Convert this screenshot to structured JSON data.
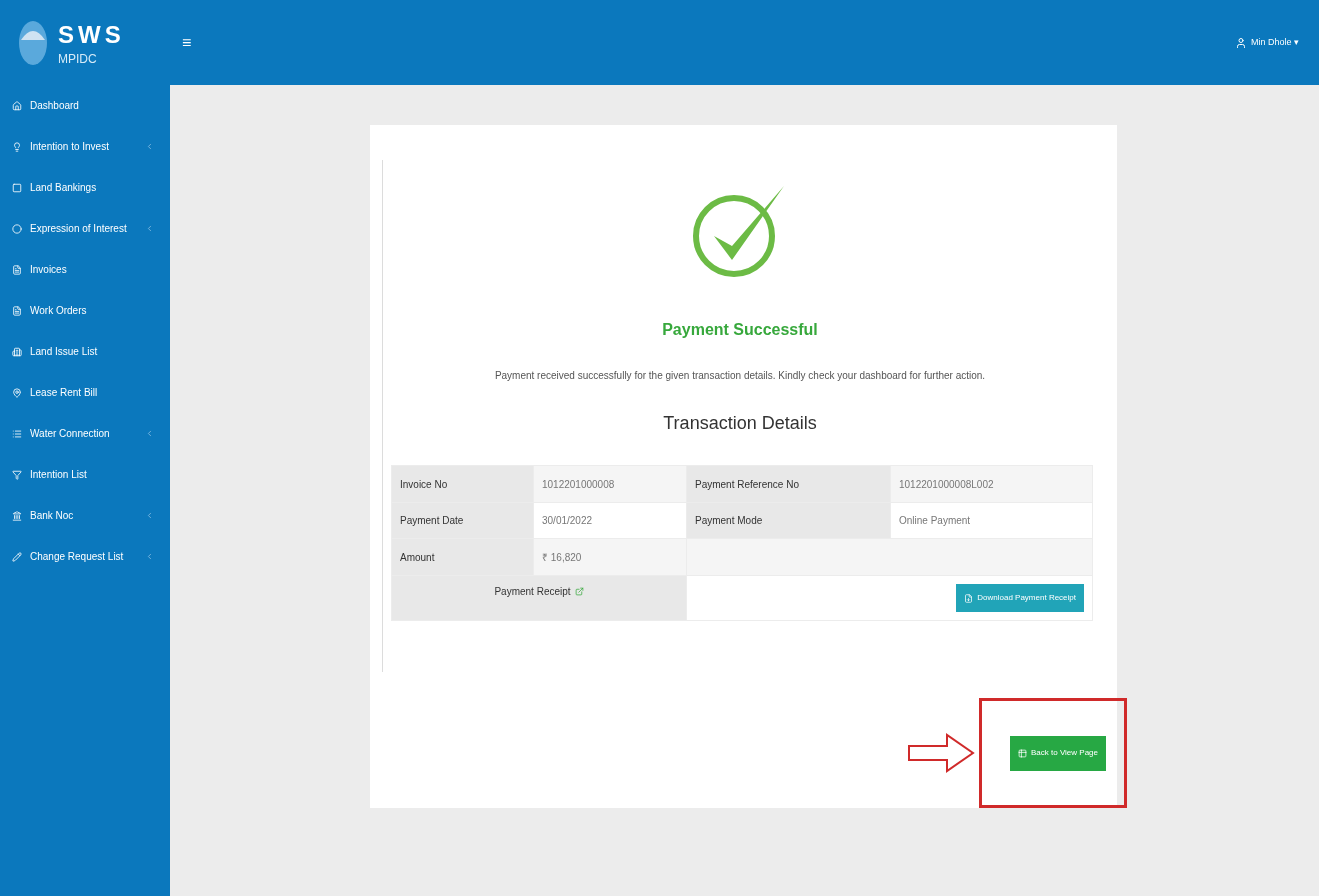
{
  "brand": {
    "title": "SWS",
    "subtitle": "MPIDC"
  },
  "header": {
    "menu_glyph": "≡",
    "user": "Min Dhole",
    "caret": "▾"
  },
  "sidebar": {
    "items": [
      {
        "label": "Dashboard",
        "has_submenu": false
      },
      {
        "label": "Intention to Invest",
        "has_submenu": true
      },
      {
        "label": "Land Bankings",
        "has_submenu": false
      },
      {
        "label": "Expression of Interest",
        "has_submenu": true
      },
      {
        "label": "Invoices",
        "has_submenu": false
      },
      {
        "label": "Work Orders",
        "has_submenu": false
      },
      {
        "label": "Land Issue List",
        "has_submenu": false
      },
      {
        "label": "Lease Rent Bill",
        "has_submenu": false
      },
      {
        "label": "Water Connection",
        "has_submenu": true
      },
      {
        "label": "Intention List",
        "has_submenu": false
      },
      {
        "label": "Bank Noc",
        "has_submenu": true
      },
      {
        "label": "Change Request List",
        "has_submenu": true
      }
    ]
  },
  "result": {
    "title": "Payment Successful",
    "message": "Payment received successfully for the given transaction details. Kindly check your dashboard for further action.",
    "details_title": "Transaction Details"
  },
  "table": {
    "rows": [
      {
        "cells": [
          "Invoice No",
          "1012201000008",
          "Payment Reference No",
          "1012201000008L002"
        ]
      },
      {
        "cells": [
          "Payment Date",
          "30/01/2022",
          "Payment Mode",
          "Online Payment"
        ]
      },
      {
        "cells": [
          "Amount",
          "₹ 16,820"
        ]
      }
    ],
    "receipt": {
      "label": "Payment Receipt",
      "button": "Download Payment Receipt"
    }
  },
  "back_button": "Back to View Page"
}
